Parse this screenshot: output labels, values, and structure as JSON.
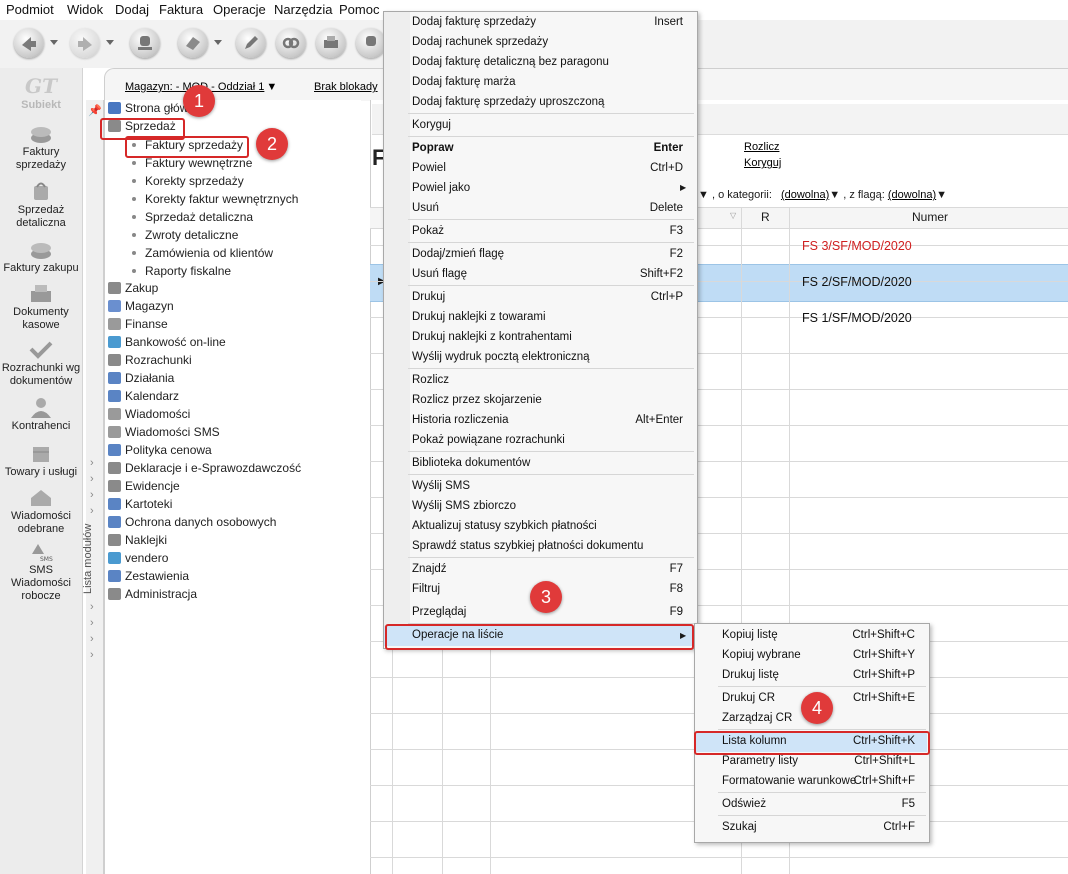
{
  "menubar": [
    "Podmiot",
    "Widok",
    "Dodaj",
    "Faktura",
    "Operacje",
    "Narzędzia",
    "Pomoc"
  ],
  "logo": "Subiekt",
  "left_strip": [
    {
      "label": "Faktury sprzedaży",
      "icon": "coins-icon"
    },
    {
      "label": "Sprzedaż detaliczna",
      "icon": "bag-icon"
    },
    {
      "label": "Faktury zakupu",
      "icon": "coins-icon"
    },
    {
      "label": "Dokumenty kasowe",
      "icon": "cash-register-icon"
    },
    {
      "label": "Rozrachunki wg dokumentów",
      "icon": "settlement-icon"
    },
    {
      "label": "Kontrahenci",
      "icon": "person-icon"
    },
    {
      "label": "Towary i usługi",
      "icon": "box-icon"
    },
    {
      "label": "Wiadomości odebrane",
      "icon": "inbox-icon"
    },
    {
      "label": "SMS Wiadomości robocze",
      "icon": "sms-icon"
    }
  ],
  "header": {
    "magazyn": "Magazyn: - MOD - Oddział 1",
    "blokady": "Brak blokady",
    "rozlicz": "Rozlicz",
    "koryguj": "Koryguj",
    "title_letter": "F",
    "filter_kategorii_label": ", o kategorii:",
    "filter_kategorii_value": "(dowolna)",
    "filter_flaga_label": ", z flagą:",
    "filter_flaga_value": "(dowolna)"
  },
  "tree_sidebar_label": "Lista modułów",
  "tree": [
    {
      "label": "Strona główna",
      "color": "#4a78c2"
    },
    {
      "label": "Sprzedaż",
      "color": "#8a8a8a"
    },
    {
      "label": "Zakup",
      "color": "#8a8a8a"
    },
    {
      "label": "Magazyn",
      "color": "#6a8fcf"
    },
    {
      "label": "Finanse",
      "color": "#9a9a9a"
    },
    {
      "label": "Bankowość on-line",
      "color": "#4a9ad0"
    },
    {
      "label": "Rozrachunki",
      "color": "#8a8a8a"
    },
    {
      "label": "Działania",
      "color": "#5a84c4"
    },
    {
      "label": "Kalendarz",
      "color": "#5a84c4"
    },
    {
      "label": "Wiadomości",
      "color": "#9a9a9a"
    },
    {
      "label": "Wiadomości SMS",
      "color": "#9a9a9a"
    },
    {
      "label": "Polityka cenowa",
      "color": "#5a84c4"
    },
    {
      "label": "Deklaracje i e-Sprawozdawczość",
      "color": "#8a8a8a"
    },
    {
      "label": "Ewidencje",
      "color": "#8a8a8a"
    },
    {
      "label": "Kartoteki",
      "color": "#5a84c4"
    },
    {
      "label": "Ochrona danych osobowych",
      "color": "#5a84c4"
    },
    {
      "label": "Naklejki",
      "color": "#8a8a8a"
    },
    {
      "label": "vendero",
      "color": "#4a9ad0"
    },
    {
      "label": "Zestawienia",
      "color": "#5a84c4"
    },
    {
      "label": "Administracja",
      "color": "#8a8a8a"
    }
  ],
  "sprzedaz_sub": [
    "Faktury sprzedaży",
    "Faktury wewnętrzne",
    "Korekty sprzedaży",
    "Korekty faktur wewnętrznych",
    "Sprzedaż detaliczna",
    "Zwroty detaliczne",
    "Zamówienia od klientów",
    "Raporty fiskalne"
  ],
  "grid": {
    "col_r": "R",
    "col_numer": "Numer",
    "rows": [
      {
        "numer": "FS 3/SF/MOD/2020",
        "color": "#d02020"
      },
      {
        "numer": "FS 2/SF/MOD/2020",
        "color": "#111111"
      },
      {
        "numer": "FS 1/SF/MOD/2020",
        "color": "#111111"
      }
    ]
  },
  "context_menu": [
    {
      "label": "Dodaj fakturę sprzedaży",
      "shortcut": "Insert"
    },
    {
      "label": "Dodaj rachunek sprzedaży",
      "shortcut": ""
    },
    {
      "label": "Dodaj fakturę detaliczną bez paragonu",
      "shortcut": ""
    },
    {
      "label": "Dodaj fakturę marża",
      "shortcut": ""
    },
    {
      "label": "Dodaj fakturę sprzedaży uproszczoną",
      "shortcut": ""
    },
    {
      "label": "Koryguj",
      "shortcut": ""
    },
    {
      "label": "Popraw",
      "shortcut": "Enter"
    },
    {
      "label": "Powiel",
      "shortcut": "Ctrl+D"
    },
    {
      "label": "Powiel jako",
      "shortcut": ""
    },
    {
      "label": "Usuń",
      "shortcut": "Delete"
    },
    {
      "label": "Pokaż",
      "shortcut": "F3"
    },
    {
      "label": "Dodaj/zmień flagę",
      "shortcut": "F2"
    },
    {
      "label": "Usuń flagę",
      "shortcut": "Shift+F2"
    },
    {
      "label": "Drukuj",
      "shortcut": "Ctrl+P"
    },
    {
      "label": "Drukuj naklejki z towarami",
      "shortcut": ""
    },
    {
      "label": "Drukuj naklejki z kontrahentami",
      "shortcut": ""
    },
    {
      "label": "Wyślij wydruk pocztą elektroniczną",
      "shortcut": ""
    },
    {
      "label": "Rozlicz",
      "shortcut": ""
    },
    {
      "label": "Rozlicz przez skojarzenie",
      "shortcut": ""
    },
    {
      "label": "Historia rozliczenia",
      "shortcut": "Alt+Enter"
    },
    {
      "label": "Pokaż powiązane rozrachunki",
      "shortcut": ""
    },
    {
      "label": "Biblioteka dokumentów",
      "shortcut": ""
    },
    {
      "label": "Wyślij SMS",
      "shortcut": ""
    },
    {
      "label": "Wyślij SMS zbiorczo",
      "shortcut": ""
    },
    {
      "label": "Aktualizuj statusy szybkich płatności",
      "shortcut": ""
    },
    {
      "label": "Sprawdź status szybkiej płatności dokumentu",
      "shortcut": ""
    },
    {
      "label": "Znajdź",
      "shortcut": "F7"
    },
    {
      "label": "Filtruj",
      "shortcut": "F8"
    },
    {
      "label": "Przeglądaj",
      "shortcut": "F9"
    },
    {
      "label": "Operacje na liście",
      "shortcut": ""
    }
  ],
  "submenu": [
    {
      "label": "Kopiuj listę",
      "shortcut": "Ctrl+Shift+C"
    },
    {
      "label": "Kopiuj wybrane",
      "shortcut": "Ctrl+Shift+Y"
    },
    {
      "label": "Drukuj listę",
      "shortcut": "Ctrl+Shift+P"
    },
    {
      "label": "Drukuj CR",
      "shortcut": "Ctrl+Shift+E"
    },
    {
      "label": "Zarządzaj CR",
      "shortcut": ""
    },
    {
      "label": "Lista kolumn",
      "shortcut": "Ctrl+Shift+K"
    },
    {
      "label": "Parametry listy",
      "shortcut": "Ctrl+Shift+L"
    },
    {
      "label": "Formatowanie warunkowe",
      "shortcut": "Ctrl+Shift+F"
    },
    {
      "label": "Odśwież",
      "shortcut": "F5"
    },
    {
      "label": "Szukaj",
      "shortcut": "Ctrl+F"
    }
  ],
  "badges": [
    "1",
    "2",
    "3",
    "4"
  ],
  "colors": {
    "accent_red": "#d62828",
    "selection": "#bfdcf5"
  }
}
